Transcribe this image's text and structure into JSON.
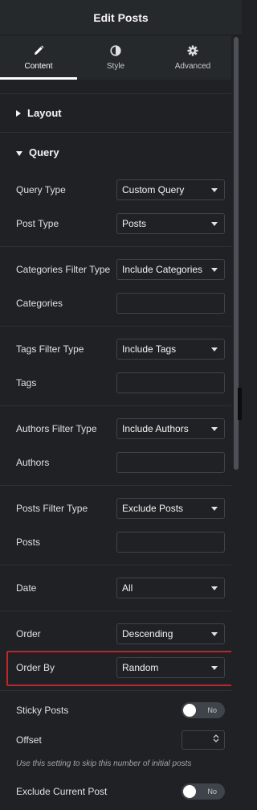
{
  "header": {
    "title": "Edit Posts"
  },
  "tabs": [
    {
      "label": "Content",
      "icon": "pencil-icon",
      "active": true
    },
    {
      "label": "Style",
      "icon": "half-circle-icon",
      "active": false
    },
    {
      "label": "Advanced",
      "icon": "gear-icon",
      "active": false
    }
  ],
  "sections": {
    "layout": {
      "label": "Layout",
      "expanded": false
    },
    "query": {
      "label": "Query",
      "expanded": true
    }
  },
  "fields": {
    "query_type": {
      "label": "Query Type",
      "value": "Custom Query"
    },
    "post_type": {
      "label": "Post Type",
      "value": "Posts"
    },
    "categories_filter_type": {
      "label": "Categories Filter Type",
      "value": "Include Categories"
    },
    "categories": {
      "label": "Categories",
      "value": ""
    },
    "tags_filter_type": {
      "label": "Tags Filter Type",
      "value": "Include Tags"
    },
    "tags": {
      "label": "Tags",
      "value": ""
    },
    "authors_filter_type": {
      "label": "Authors Filter Type",
      "value": "Include Authors"
    },
    "authors": {
      "label": "Authors",
      "value": ""
    },
    "posts_filter_type": {
      "label": "Posts Filter Type",
      "value": "Exclude Posts"
    },
    "posts": {
      "label": "Posts",
      "value": ""
    },
    "date": {
      "label": "Date",
      "value": "All"
    },
    "order": {
      "label": "Order",
      "value": "Descending"
    },
    "order_by": {
      "label": "Order By",
      "value": "Random"
    },
    "sticky_posts": {
      "label": "Sticky Posts",
      "toggle": "No"
    },
    "offset": {
      "label": "Offset",
      "value": ""
    },
    "offset_note": "Use this setting to skip this number of initial posts",
    "exclude_current_post": {
      "label": "Exclude Current Post",
      "toggle": "No"
    }
  },
  "colors": {
    "highlight": "#e8141c",
    "background": "#1f2124",
    "header": "#26292c"
  }
}
